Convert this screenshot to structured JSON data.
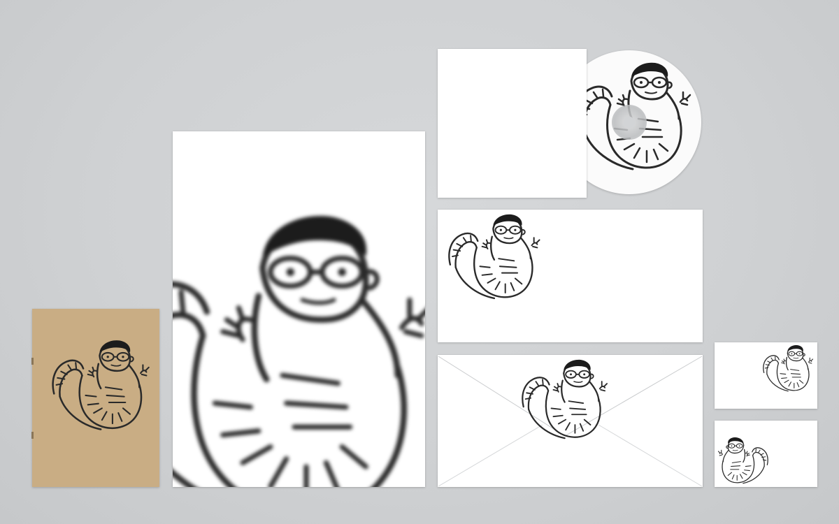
{
  "scene": {
    "description_items": [
      {
        "name": "kraft-booklet"
      },
      {
        "name": "letterhead-sheet"
      },
      {
        "name": "cd-sleeve"
      },
      {
        "name": "cd-disc"
      },
      {
        "name": "dl-envelope-front"
      },
      {
        "name": "envelope-back"
      },
      {
        "name": "business-card-front"
      },
      {
        "name": "business-card-back"
      }
    ],
    "colors": {
      "background": "#cfd1d3",
      "paper": "#ffffff",
      "kraft": "#c9ad84",
      "ink": "#2a2a2a"
    },
    "illustration": "caterpillar-man-with-glasses"
  }
}
